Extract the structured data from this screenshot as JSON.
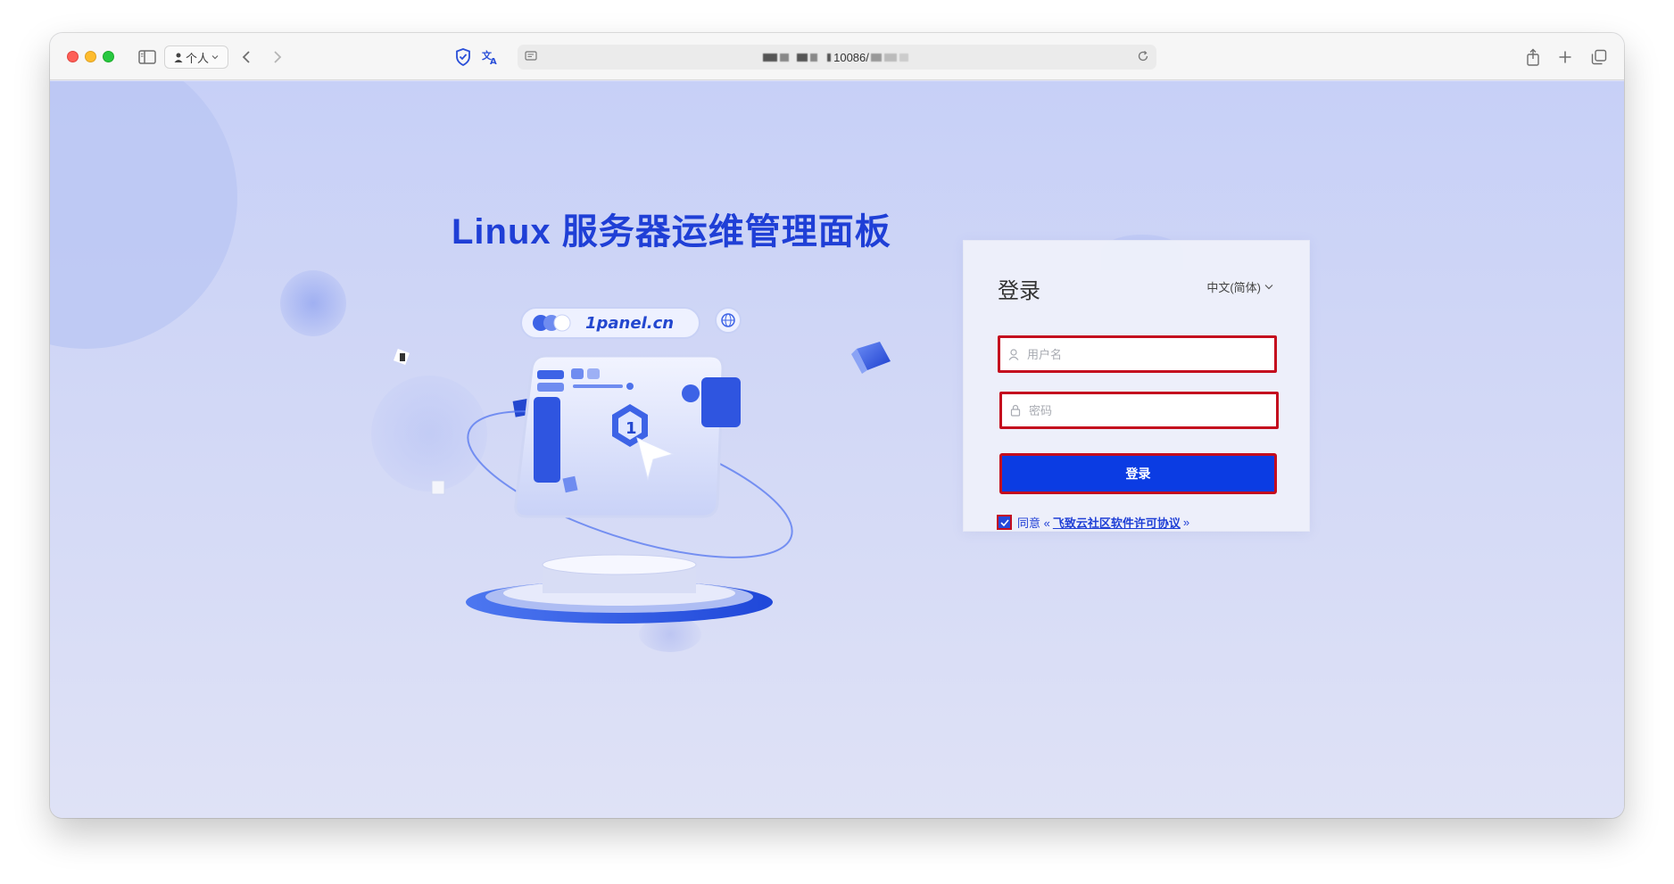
{
  "browser": {
    "profile_label": "个人",
    "address": "10086/"
  },
  "page": {
    "headline": "Linux 服务器运维管理面板",
    "illustration_url_label": "1panel.cn"
  },
  "login": {
    "title": "登录",
    "language": "中文(简体)",
    "username_placeholder": "用户名",
    "password_placeholder": "密码",
    "submit_label": "登录",
    "agree_prefix": "同意 «",
    "agree_link": "飞致云社区软件许可协议",
    "agree_suffix": "»",
    "agree_checked": true
  },
  "colors": {
    "accent": "#0b3ce3",
    "headline": "#1f3fd6",
    "highlight_border": "#c40d1e"
  }
}
